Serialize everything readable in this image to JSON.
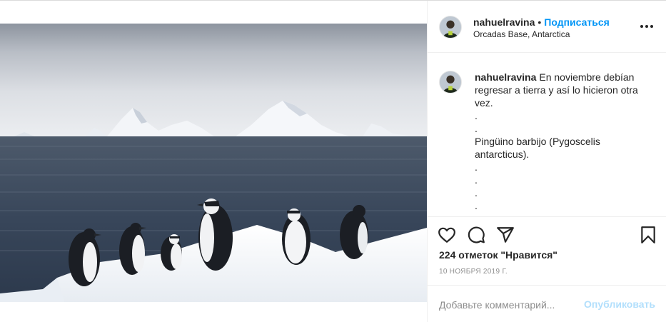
{
  "post": {
    "author": {
      "username": "nahuelravina",
      "follow_label": "Подписаться",
      "location": "Orcadas Base, Antarctica"
    },
    "caption": {
      "username": "nahuelravina",
      "lines": [
        "En noviembre debían regresar a tierra y así lo hicieron otra vez.",
        ".",
        ".",
        "Pingüino barbijo (Pygoscelis antarcticus).",
        ".",
        ".",
        ".",
        "."
      ]
    },
    "likes_text": "224 отметок \"Нравится\"",
    "date_text": "10 ноября 2019 г.",
    "comment_input": {
      "placeholder": "Добавьте комментарий...",
      "value": ""
    },
    "publish_label": "Опубликовать"
  },
  "icons": {
    "like": "heart-icon",
    "comment": "comment-bubble-icon",
    "share": "paper-plane-icon",
    "save": "bookmark-icon",
    "more": "more-horizontal-icon"
  },
  "colors": {
    "link_blue": "#0095f6",
    "publish_disabled": "#b2dffc",
    "muted_text": "#8e8e8e"
  }
}
